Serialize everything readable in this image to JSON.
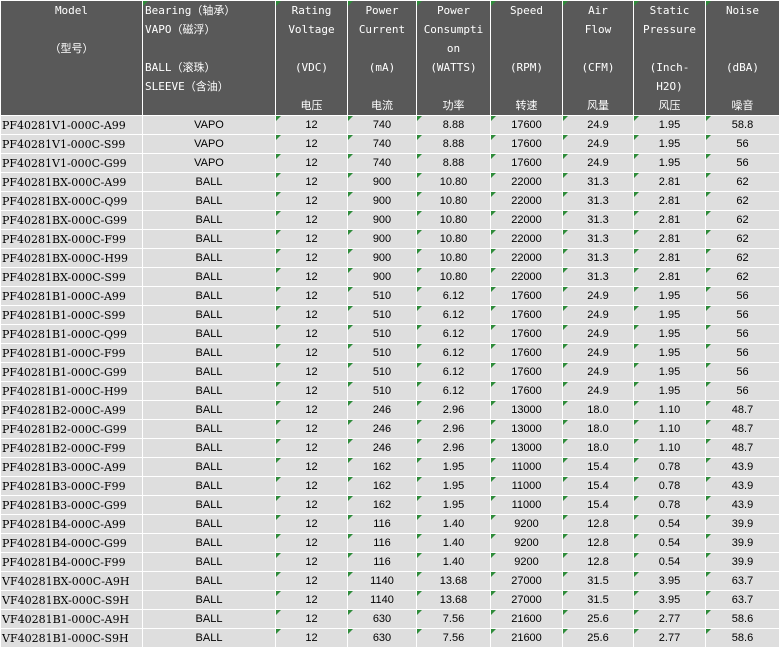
{
  "columns": [
    {
      "lines": [
        "Model",
        "",
        "（型号）",
        "",
        ""
      ]
    },
    {
      "lines": [
        "Bearing（轴承）",
        "VAPO（磁浮）",
        "",
        "BALL（滚珠）",
        "SLEEVE（含油）"
      ]
    },
    {
      "lines": [
        "Rating",
        "Voltage",
        "",
        "(VDC)",
        "",
        "电压"
      ]
    },
    {
      "lines": [
        "Power",
        "Current",
        "",
        "(mA)",
        "",
        "电流"
      ]
    },
    {
      "lines": [
        "Power",
        "Consumpti",
        "on",
        "(WATTS)",
        "",
        "功率"
      ]
    },
    {
      "lines": [
        "Speed",
        "",
        "",
        "(RPM)",
        "",
        "转速"
      ]
    },
    {
      "lines": [
        "Air",
        "Flow",
        "",
        "(CFM)",
        "",
        "风量"
      ]
    },
    {
      "lines": [
        "Static",
        "Pressure",
        "",
        "(Inch-",
        "H2O)",
        "风压"
      ]
    },
    {
      "lines": [
        "Noise",
        "",
        "",
        "(dBA)",
        "",
        "噪音"
      ]
    }
  ],
  "rows": [
    [
      "PF40281V1-000C-A99",
      "VAPO",
      "12",
      "740",
      "8.88",
      "17600",
      "24.9",
      "1.95",
      "58.8"
    ],
    [
      "PF40281V1-000C-S99",
      "VAPO",
      "12",
      "740",
      "8.88",
      "17600",
      "24.9",
      "1.95",
      "56"
    ],
    [
      "PF40281V1-000C-G99",
      "VAPO",
      "12",
      "740",
      "8.88",
      "17600",
      "24.9",
      "1.95",
      "56"
    ],
    [
      "PF40281BX-000C-A99",
      "BALL",
      "12",
      "900",
      "10.80",
      "22000",
      "31.3",
      "2.81",
      "62"
    ],
    [
      "PF40281BX-000C-Q99",
      "BALL",
      "12",
      "900",
      "10.80",
      "22000",
      "31.3",
      "2.81",
      "62"
    ],
    [
      "PF40281BX-000C-G99",
      "BALL",
      "12",
      "900",
      "10.80",
      "22000",
      "31.3",
      "2.81",
      "62"
    ],
    [
      "PF40281BX-000C-F99",
      "BALL",
      "12",
      "900",
      "10.80",
      "22000",
      "31.3",
      "2.81",
      "62"
    ],
    [
      "PF40281BX-000C-H99",
      "BALL",
      "12",
      "900",
      "10.80",
      "22000",
      "31.3",
      "2.81",
      "62"
    ],
    [
      "PF40281BX-000C-S99",
      "BALL",
      "12",
      "900",
      "10.80",
      "22000",
      "31.3",
      "2.81",
      "62"
    ],
    [
      "PF40281B1-000C-A99",
      "BALL",
      "12",
      "510",
      "6.12",
      "17600",
      "24.9",
      "1.95",
      "56"
    ],
    [
      "PF40281B1-000C-S99",
      "BALL",
      "12",
      "510",
      "6.12",
      "17600",
      "24.9",
      "1.95",
      "56"
    ],
    [
      "PF40281B1-000C-Q99",
      "BALL",
      "12",
      "510",
      "6.12",
      "17600",
      "24.9",
      "1.95",
      "56"
    ],
    [
      "PF40281B1-000C-F99",
      "BALL",
      "12",
      "510",
      "6.12",
      "17600",
      "24.9",
      "1.95",
      "56"
    ],
    [
      "PF40281B1-000C-G99",
      "BALL",
      "12",
      "510",
      "6.12",
      "17600",
      "24.9",
      "1.95",
      "56"
    ],
    [
      "PF40281B1-000C-H99",
      "BALL",
      "12",
      "510",
      "6.12",
      "17600",
      "24.9",
      "1.95",
      "56"
    ],
    [
      "PF40281B2-000C-A99",
      "BALL",
      "12",
      "246",
      "2.96",
      "13000",
      "18.0",
      "1.10",
      "48.7"
    ],
    [
      "PF40281B2-000C-G99",
      "BALL",
      "12",
      "246",
      "2.96",
      "13000",
      "18.0",
      "1.10",
      "48.7"
    ],
    [
      "PF40281B2-000C-F99",
      "BALL",
      "12",
      "246",
      "2.96",
      "13000",
      "18.0",
      "1.10",
      "48.7"
    ],
    [
      "PF40281B3-000C-A99",
      "BALL",
      "12",
      "162",
      "1.95",
      "11000",
      "15.4",
      "0.78",
      "43.9"
    ],
    [
      "PF40281B3-000C-F99",
      "BALL",
      "12",
      "162",
      "1.95",
      "11000",
      "15.4",
      "0.78",
      "43.9"
    ],
    [
      "PF40281B3-000C-G99",
      "BALL",
      "12",
      "162",
      "1.95",
      "11000",
      "15.4",
      "0.78",
      "43.9"
    ],
    [
      "PF40281B4-000C-A99",
      "BALL",
      "12",
      "116",
      "1.40",
      "9200",
      "12.8",
      "0.54",
      "39.9"
    ],
    [
      "PF40281B4-000C-G99",
      "BALL",
      "12",
      "116",
      "1.40",
      "9200",
      "12.8",
      "0.54",
      "39.9"
    ],
    [
      "PF40281B4-000C-F99",
      "BALL",
      "12",
      "116",
      "1.40",
      "9200",
      "12.8",
      "0.54",
      "39.9"
    ],
    [
      "VF40281BX-000C-A9H",
      "BALL",
      "12",
      "1140",
      "13.68",
      "27000",
      "31.5",
      "3.95",
      "63.7"
    ],
    [
      "VF40281BX-000C-S9H",
      "BALL",
      "12",
      "1140",
      "13.68",
      "27000",
      "31.5",
      "3.95",
      "63.7"
    ],
    [
      "VF40281B1-000C-A9H",
      "BALL",
      "12",
      "630",
      "7.56",
      "21600",
      "25.6",
      "2.77",
      "58.6"
    ],
    [
      "VF40281B1-000C-S9H",
      "BALL",
      "12",
      "630",
      "7.56",
      "21600",
      "25.6",
      "2.77",
      "58.6"
    ]
  ],
  "colors": {
    "header_bg": "#595959",
    "header_text": "#ffffff",
    "row_bg": "#dedede",
    "cell_marker": "#2e8b3a",
    "grid_line": "#ffffff"
  }
}
